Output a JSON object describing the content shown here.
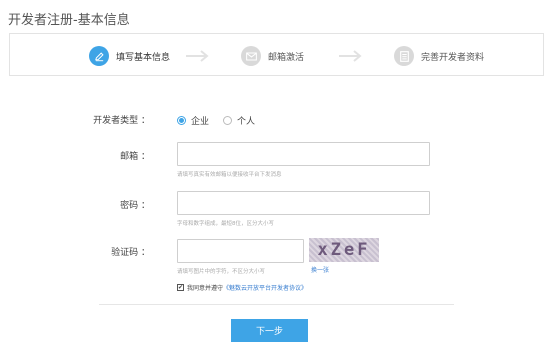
{
  "page": {
    "title": "开发者注册-基本信息"
  },
  "steps": [
    {
      "label": "填写基本信息",
      "icon": "pencil-icon",
      "state": "active"
    },
    {
      "label": "邮箱激活",
      "icon": "envelope-icon",
      "state": "idle"
    },
    {
      "label": "完善开发者资料",
      "icon": "document-icon",
      "state": "idle"
    }
  ],
  "form": {
    "developer_type": {
      "label": "开发者类型 ：",
      "options": [
        {
          "label": "企业",
          "checked": true
        },
        {
          "label": "个人",
          "checked": false
        }
      ]
    },
    "email": {
      "label": "邮箱 ：",
      "value": "",
      "hint": "请填写真实有效邮箱以便接收平台下发消息"
    },
    "password": {
      "label": "密码 ：",
      "value": "",
      "hint": "字母和数字组成，最短8位，区分大小写"
    },
    "captcha": {
      "label": "验证码 ：",
      "value": "",
      "hint": "请填写图片中的字符，不区分大小写",
      "image_text": "xZeF",
      "refresh_label": "换一张"
    },
    "agreement": {
      "checked": true,
      "prefix": "我同意并遵守",
      "link": "《魅数云开放平台开发者协议》"
    }
  },
  "actions": {
    "next_label": "下一步"
  },
  "colors": {
    "accent": "#3ea4e6",
    "link": "#3a7fd0"
  }
}
